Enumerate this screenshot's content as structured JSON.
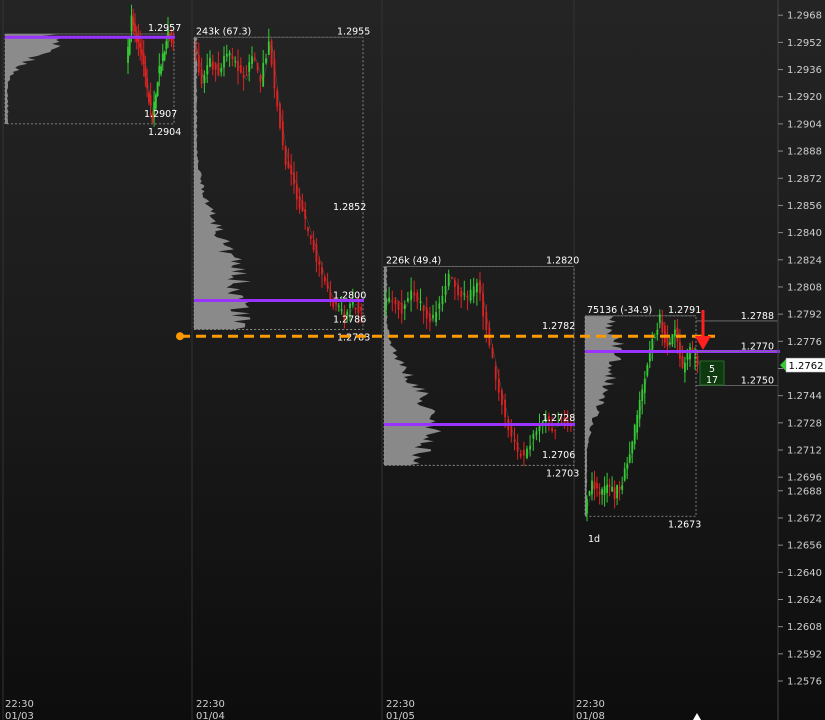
{
  "chart_data": {
    "type": "candlestick",
    "timeframe_label": "1d",
    "y_axis": {
      "range": [
        1.2566,
        1.2974
      ],
      "ticks": [
        "1.2968",
        "1.2952",
        "1.2936",
        "1.2920",
        "1.2904",
        "1.2888",
        "1.2872",
        "1.2856",
        "1.2840",
        "1.2824",
        "1.2808",
        "1.2792",
        "1.2776",
        "1.2760",
        "1.2744",
        "1.2728",
        "1.2712",
        "1.2696",
        "1.2688",
        "1.2672",
        "1.2656",
        "1.2640",
        "1.2624",
        "1.2608",
        "1.2592",
        "1.2576"
      ]
    },
    "x_axis": {
      "labels": [
        {
          "time": "22:30",
          "date": "01/03"
        },
        {
          "time": "22:30",
          "date": "01/04"
        },
        {
          "time": "22:30",
          "date": "01/05"
        },
        {
          "time": "22:30",
          "date": "01/08"
        }
      ]
    },
    "current_price": "1.2762",
    "reference_level": 1.2779,
    "sessions": [
      {
        "session_label": "",
        "high": 1.2957,
        "low": 1.2904,
        "poc": 1.2955,
        "labels": [
          "1.2957",
          "1.2907",
          "1.2904"
        ],
        "price_path": [
          1.2938,
          1.2966,
          1.2952,
          1.2943,
          1.2924,
          1.2907,
          1.2931,
          1.2944,
          1.2958,
          1.2951
        ]
      },
      {
        "session_label": "243k (67.3)",
        "high": 1.2955,
        "low": 1.2783,
        "poc": 1.28,
        "labels": [
          "1.2955",
          "1.2852",
          "1.2800",
          "1.2786",
          "1.2783"
        ],
        "price_path": [
          1.2951,
          1.2928,
          1.2941,
          1.2935,
          1.2946,
          1.2939,
          1.293,
          1.2944,
          1.2929,
          1.2953,
          1.2913,
          1.2882,
          1.2868,
          1.2851,
          1.2836,
          1.282,
          1.2805,
          1.2796,
          1.279,
          1.2798,
          1.2794
        ]
      },
      {
        "session_label": "226k (49.4)",
        "high": 1.282,
        "low": 1.2703,
        "poc": 1.2727,
        "labels": [
          "1.2820",
          "1.2782",
          "1.2728",
          "1.2706",
          "1.2703"
        ],
        "price_path": [
          1.2797,
          1.2802,
          1.2795,
          1.2804,
          1.2798,
          1.2787,
          1.2796,
          1.2814,
          1.2806,
          1.2799,
          1.2812,
          1.2782,
          1.2755,
          1.2731,
          1.2714,
          1.2708,
          1.2722,
          1.2731,
          1.2725,
          1.2729,
          1.2726
        ]
      },
      {
        "session_label": "75136 (-34.9)",
        "high": 1.2791,
        "low": 1.2673,
        "poc": 1.277,
        "labels": [
          "1.2791",
          "1.2673"
        ],
        "price_path": [
          1.2677,
          1.2693,
          1.2687,
          1.2691,
          1.2686,
          1.2694,
          1.271,
          1.2733,
          1.2756,
          1.2776,
          1.2789,
          1.2772,
          1.2785,
          1.276,
          1.2772,
          1.2762
        ]
      }
    ],
    "right_labels": [
      "1.2788",
      "1.2770",
      "1.2750"
    ],
    "order_box": {
      "top": "5",
      "bottom": "17"
    },
    "colors": {
      "up": "#33cc33",
      "down": "#dd2222",
      "poc": "#9933ff",
      "profile": "#9e9e9e",
      "reference": "#ff9900",
      "arrow": "#ff2020",
      "price_tag": "#ffffff",
      "axis_text": "#cfcfcf"
    }
  }
}
